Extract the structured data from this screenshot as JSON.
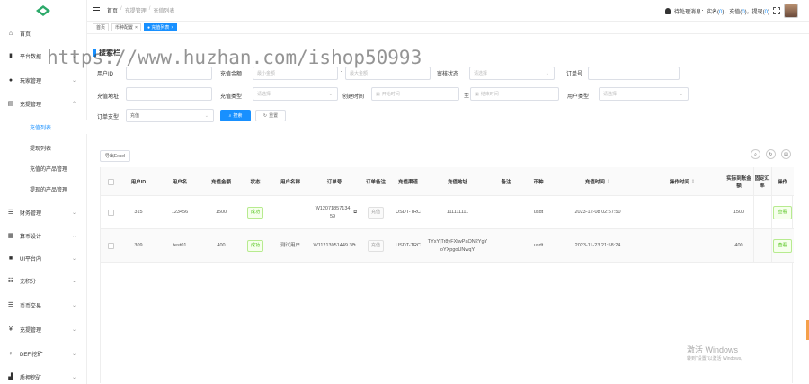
{
  "sidebar": {
    "items": [
      {
        "label": "首页",
        "icon": "home-icon",
        "glyph": "⌂"
      },
      {
        "label": "平台数据",
        "icon": "chart-icon",
        "glyph": "▮",
        "chev": "⌄"
      },
      {
        "label": "玩家管理",
        "icon": "user-icon",
        "glyph": "●",
        "chev": "⌄"
      },
      {
        "label": "充提管理",
        "icon": "wallet-icon",
        "glyph": "▤",
        "chev": "⌃"
      },
      {
        "label": "财务管理",
        "icon": "finance-icon",
        "glyph": "☰",
        "chev": "⌄"
      },
      {
        "label": "算币设计",
        "icon": "coin-icon",
        "glyph": "▦",
        "chev": "⌄"
      },
      {
        "label": "UI平台内",
        "icon": "ui-icon",
        "glyph": "■",
        "chev": "⌄"
      },
      {
        "label": "充积分",
        "icon": "points-icon",
        "glyph": "☷",
        "chev": "⌄"
      },
      {
        "label": "币币交易",
        "icon": "exchange-icon",
        "glyph": "☰",
        "chev": "⌄"
      },
      {
        "label": "充提管理",
        "icon": "yen-icon",
        "glyph": "¥",
        "chev": "⌄"
      },
      {
        "label": "DEFI挖矿",
        "icon": "defi-icon",
        "glyph": "♀",
        "chev": "⌄"
      },
      {
        "label": "质押挖矿",
        "icon": "stake-icon",
        "glyph": "▟",
        "chev": "⌄"
      }
    ],
    "subitems": [
      {
        "label": "充值列表",
        "active": true
      },
      {
        "label": "提现列表",
        "active": false
      },
      {
        "label": "充值的产品管理",
        "active": false
      },
      {
        "label": "提现的产品管理",
        "active": false
      }
    ]
  },
  "header": {
    "breadcrumb": [
      "首页",
      "/",
      "充提管理",
      "/",
      "充值列表"
    ],
    "notification_prefix": "待处理消息：实名(",
    "n1": "0",
    "notification_mid1": ")，充值(",
    "n2": "0",
    "notification_mid2": ")，提现(",
    "n3": "0",
    "notification_suffix": ")"
  },
  "tags": [
    {
      "label": "首页",
      "active": false,
      "closable": false
    },
    {
      "label": "币种配置",
      "active": false,
      "closable": true
    },
    {
      "label": "● 充值列表",
      "active": true,
      "closable": true
    }
  ],
  "search": {
    "title": "搜索栏",
    "fields": {
      "user_id": {
        "label": "用户ID",
        "placeholder": ""
      },
      "amount": {
        "label": "充值金额",
        "min_placeholder": "最小金额",
        "max_placeholder": "最大金额",
        "sep": "-"
      },
      "audit_status": {
        "label": "审核状态",
        "placeholder": "请选择"
      },
      "order_no": {
        "label": "订单号",
        "placeholder": ""
      },
      "address": {
        "label": "充值地址",
        "placeholder": ""
      },
      "recharge_type": {
        "label": "充值类型",
        "placeholder": "请选择"
      },
      "create_time": {
        "label": "创建时间",
        "start_placeholder": "开始时间",
        "end_placeholder": "结束时间",
        "sep": "至"
      },
      "user_type": {
        "label": "用户类型",
        "placeholder": "请选择"
      },
      "order_type": {
        "label": "订单支型",
        "value": "充值"
      }
    },
    "search_button": "搜索",
    "reset_button": "重置"
  },
  "table": {
    "export_button": "导出Excel",
    "headers": [
      "",
      "用户ID",
      "用户名",
      "充值金额",
      "状态",
      "用户名称",
      "订单号",
      "订单备注",
      "充值渠道",
      "充值地址",
      "备注",
      "币种",
      "充值时间",
      "操作时间",
      "实际到账金额",
      "固定汇率",
      "操作"
    ],
    "rows": [
      {
        "user_id": "315",
        "username": "123456",
        "amount": "1500",
        "status": "成功",
        "status_style": "green",
        "user_label": "",
        "order_no": "W12071857134 59",
        "order_note": "充值",
        "channel": "USDT-TRC",
        "address": "111111111",
        "remark": "",
        "currency": "usdt",
        "recharge_time": "2023-12-08 02:57:50",
        "operate_time": "",
        "actual_amount": "1500",
        "op_label": "查看"
      },
      {
        "user_id": "309",
        "username": "test01",
        "amount": "400",
        "status": "成功",
        "status_style": "green",
        "user_label": "测试用户",
        "order_no": "W11213051449 3",
        "order_note": "充值",
        "channel": "USDT-TRC",
        "address": "TYxYjTr8yFXfwPaON2YgYoYXpgoUNwqY",
        "remark": "",
        "currency": "usdt",
        "recharge_time": "2023-11-23 21:58:24",
        "operate_time": "",
        "actual_amount": "400",
        "op_label": "查看"
      }
    ]
  },
  "overlay": {
    "watermark": "https://www.huzhan.com/ishop50993",
    "win_activate_title": "激活 Windows",
    "win_activate_sub": "转到\"设置\"以激活 Windows。"
  },
  "colors": {
    "primary": "#1890ff",
    "success": "#52c41a"
  }
}
